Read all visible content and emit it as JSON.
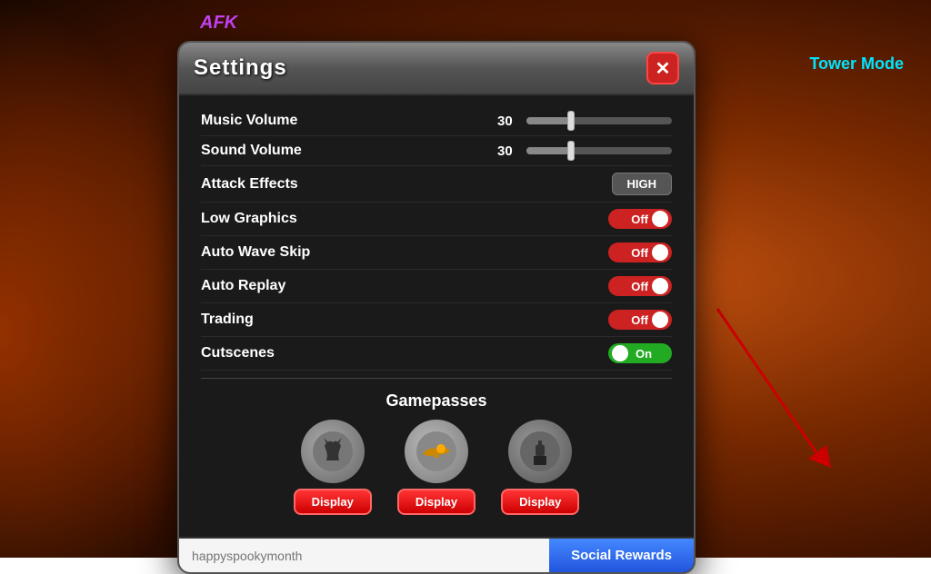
{
  "background": {
    "afk_label": "AFK",
    "tower_mode_label": "Tower Mode"
  },
  "modal": {
    "title": "Settings",
    "close_btn": "✕",
    "settings": {
      "music_volume_label": "Music Volume",
      "music_volume_value": "30",
      "sound_volume_label": "Sound Volume",
      "sound_volume_value": "30",
      "attack_effects_label": "Attack Effects",
      "attack_effects_value": "HIGH",
      "low_graphics_label": "Low Graphics",
      "low_graphics_value": "Off",
      "auto_wave_skip_label": "Auto Wave Skip",
      "auto_wave_skip_value": "Off",
      "auto_replay_label": "Auto Replay",
      "auto_replay_value": "Off",
      "trading_label": "Trading",
      "trading_value": "Off",
      "cutscenes_label": "Cutscenes",
      "cutscenes_value": "On"
    },
    "gamepasses": {
      "title": "Gamepasses",
      "items": [
        {
          "display_label": "Display"
        },
        {
          "display_label": "Display"
        },
        {
          "display_label": "Display"
        }
      ]
    },
    "footer": {
      "code_placeholder": "happyspookymonth",
      "social_rewards_label": "Social Rewards"
    }
  }
}
